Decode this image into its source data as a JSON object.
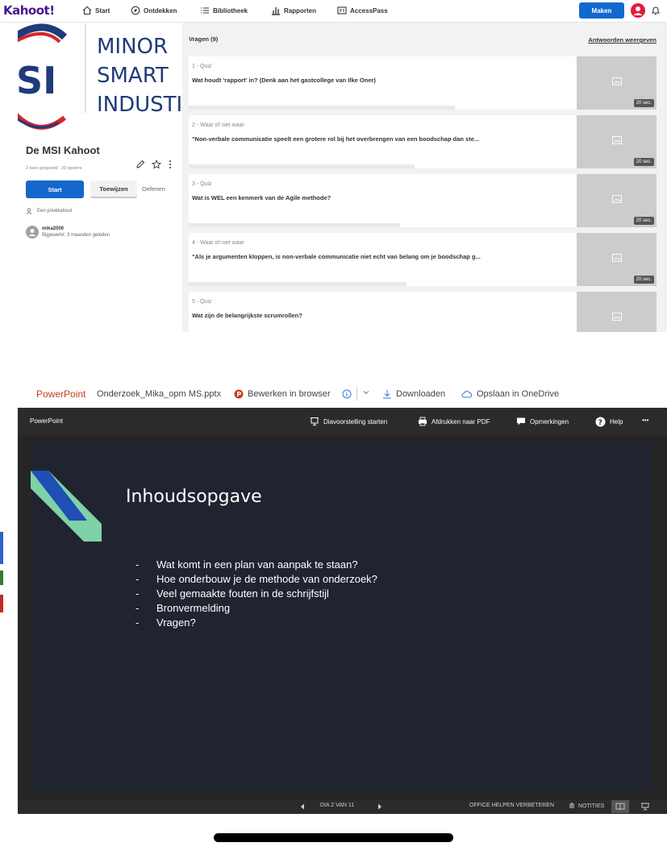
{
  "kahoot": {
    "logo": "Kahoot!",
    "nav": [
      {
        "label": "Start",
        "icon": "home-icon"
      },
      {
        "label": "Ontdekken",
        "icon": "compass-icon"
      },
      {
        "label": "Bibliotheek",
        "icon": "list-icon"
      },
      {
        "label": "Rapporten",
        "icon": "bar-chart-icon"
      },
      {
        "label": "AccessPass",
        "icon": "pass-icon"
      }
    ],
    "create_label": "Maken",
    "cover_text": [
      "MINOR",
      "SMART",
      "INDUSTI"
    ],
    "cover_logo_text": "SI",
    "title": "De MSI Kahoot",
    "meta": "2 keer gespeeld · 29 spelers",
    "start_label": "Start",
    "assign_label": "Toewijzen",
    "practice_label": "Oefenen",
    "private_label": "Een privékahoot",
    "user": {
      "name": "mika2000",
      "updated": "Bijgewerkt: 3 maanden geleden"
    },
    "questions_header": "Vragen (9)",
    "show_answers_label": "Antwoorden weergeven",
    "questions": [
      {
        "type": "1 - Quiz",
        "text": "Wat houdt 'rapport' in? (Denk aan het gastcollege van Ilke Oner)",
        "time": "20 sec."
      },
      {
        "type": "2 - Waar of niet waar",
        "text": "\"Non-verbale communicatie speelt een grotere rol bij het overbrengen van een boodschap dan ste...",
        "time": "20 sec."
      },
      {
        "type": "3 - Quiz",
        "text": "Wat is WEL een kenmerk van de Agile methode?",
        "time": "20 sec."
      },
      {
        "type": "4 - Waar of niet waar",
        "text": "\"Als je argumenten kloppen, is non-verbale communicatie niet echt van belang om je boodschap g...",
        "time": "20 sec."
      },
      {
        "type": "5 - Quiz",
        "text": "Wat zijn de belangrijkste scrumrollen?",
        "time": ""
      }
    ],
    "colors": {
      "brand": "#46178f",
      "primary": "#1368ce",
      "avatar": "#e21b3c"
    }
  },
  "powerpoint": {
    "app_name": "PowerPoint",
    "file_name": "Onderzoek_Mika_opm MS.pptx",
    "edit_in_browser": "Bewerken in browser",
    "download": "Downloaden",
    "save_onedrive": "Opslaan in OneDrive",
    "toolbar_brand": "PowerPoint",
    "slideshow": "Diavoorstelling starten",
    "print_pdf": "Afdrukken naar PDF",
    "comments": "Opmerkingen",
    "help": "Help",
    "more": "•••",
    "slide": {
      "title": "Inhoudsopgave",
      "bullets": [
        "Wat komt in een plan van aanpak te staan?",
        "Hoe onderbouw je de methode van onderzoek?",
        "Veel gemaakte fouten in de schrijfstijl",
        "Bronvermelding",
        "Vragen?"
      ]
    },
    "status": {
      "slide_counter": "DIA 2 VAN 11",
      "improve": "OFFICE HELPEN VERBETEREN",
      "notes": "NOTITIES"
    },
    "colors": {
      "accent": "#c43e1c",
      "slide_bg": "#1f2430",
      "shape_blue": "#1f4fb4",
      "shape_green": "#7fd1a8"
    }
  }
}
